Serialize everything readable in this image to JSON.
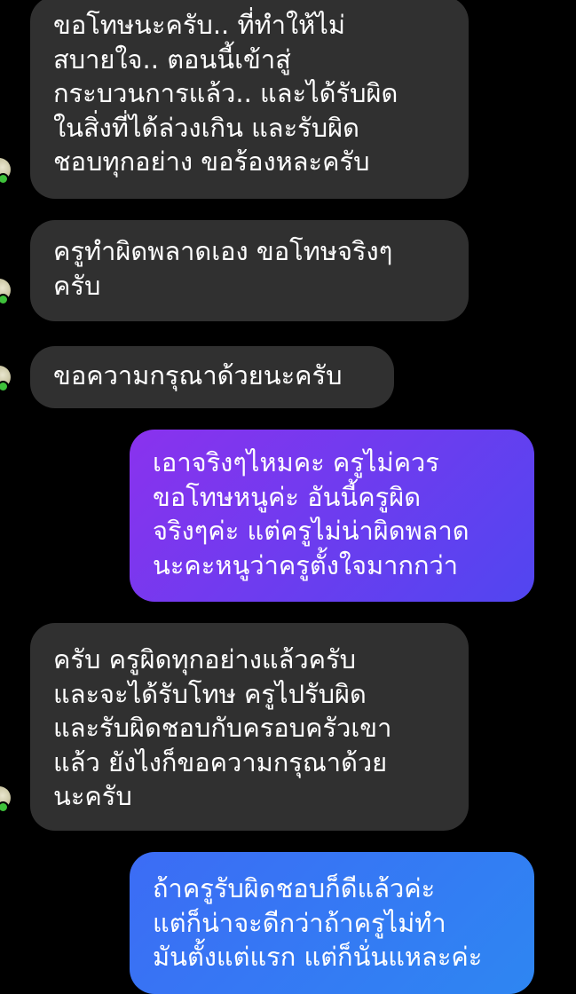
{
  "colors": {
    "background": "#000000",
    "incoming_bubble": "#303030",
    "outgoing_gradient_purple_start": "#8a32ee",
    "outgoing_gradient_purple_end": "#5146f0",
    "outgoing_gradient_blue_start": "#3c6cf5",
    "outgoing_gradient_blue_end": "#2e86f2",
    "text": "#ffffff",
    "presence": "#3ec13a"
  },
  "messages": [
    {
      "direction": "incoming",
      "text": "ขอโทษนะครับ.. ที่ทำให้ไม่\nสบายใจ.. ตอนนี้เข้าสู่\nกระบวนการแล้ว.. และได้รับผิด\nในสิ่งที่ได้ล่วงเกิน และรับผิด\nชอบทุกอย่าง ขอร้องหละครับ"
    },
    {
      "direction": "incoming",
      "text": "ครูทำผิดพลาดเอง ขอโทษจริงๆ\nครับ"
    },
    {
      "direction": "incoming",
      "text": "ขอความกรุณาด้วยนะครับ"
    },
    {
      "direction": "outgoing",
      "text": "เอาจริงๆไหมคะ ครูไม่ควร\nขอโทษหนูค่ะ อันนี้ครูผิด\nจริงๆค่ะ แต่ครูไม่น่าผิดพลาด\nนะคะหนูว่าครูตั้งใจมากกว่า"
    },
    {
      "direction": "incoming",
      "text": "ครับ ครูผิดทุกอย่างแล้วครับ\nและจะได้รับโทษ ครูไปรับผิด\nและรับผิดชอบกับครอบครัวเขา\nแล้ว ยังไงก็ขอความกรุณาด้วย\nนะครับ"
    },
    {
      "direction": "outgoing",
      "text": "ถ้าครูรับผิดชอบก็ดีแล้วค่ะ\nแต่ก็น่าจะดีกว่าถ้าครูไม่ทำ\nมันตั้งแต่แรก แต่ก็นั่นแหละค่ะ"
    }
  ]
}
